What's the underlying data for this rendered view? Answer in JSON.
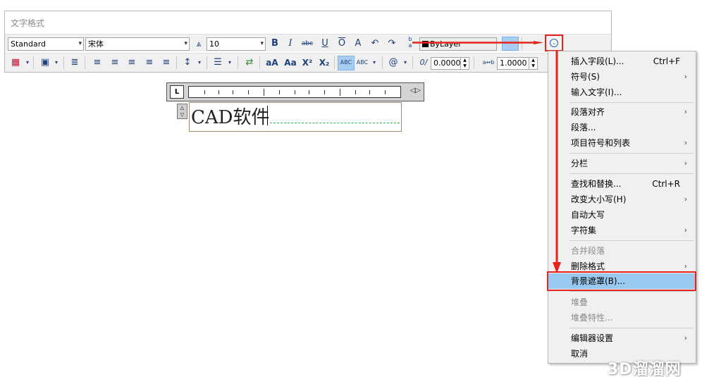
{
  "window": {
    "title": "文字格式"
  },
  "toolbar": {
    "style_value": "Standard",
    "font_value": "宋体",
    "height_value": "10",
    "bold": "B",
    "italic": "I",
    "strike": "abc",
    "underline": "U",
    "overline": "O",
    "stack_top": "b",
    "stack_bottom": "a",
    "color_value": "ByLayer",
    "oblique_value": "0.0000",
    "width_value": "1.0000",
    "uppercase": "aA",
    "lowercase": "Aa",
    "superscript": "X²",
    "subscript": "X₂",
    "symbol": "@",
    "oblique_label": "0/",
    "tracking_label": "a↔b"
  },
  "editor": {
    "text": "CAD软件"
  },
  "menu": {
    "items": [
      {
        "label": "插入字段(L)...",
        "shortcut": "Ctrl+F",
        "submenu": "",
        "disabled": false
      },
      {
        "label": "符号(S)",
        "shortcut": "",
        "submenu": "›",
        "disabled": false
      },
      {
        "label": "输入文字(I)...",
        "shortcut": "",
        "submenu": "",
        "disabled": false
      },
      {
        "label": "段落对齐",
        "shortcut": "",
        "submenu": "›",
        "disabled": false
      },
      {
        "label": "段落...",
        "shortcut": "",
        "submenu": "",
        "disabled": false
      },
      {
        "label": "项目符号和列表",
        "shortcut": "",
        "submenu": "›",
        "disabled": false
      },
      {
        "label": "分栏",
        "shortcut": "",
        "submenu": "›",
        "disabled": false
      },
      {
        "label": "查找和替换...",
        "shortcut": "Ctrl+R",
        "submenu": "",
        "disabled": false
      },
      {
        "label": "改变大小写(H)",
        "shortcut": "",
        "submenu": "›",
        "disabled": false
      },
      {
        "label": "自动大写",
        "shortcut": "",
        "submenu": "",
        "disabled": false
      },
      {
        "label": "字符集",
        "shortcut": "",
        "submenu": "›",
        "disabled": false
      },
      {
        "label": "合并段落",
        "shortcut": "",
        "submenu": "",
        "disabled": true
      },
      {
        "label": "删除格式",
        "shortcut": "",
        "submenu": "›",
        "disabled": false
      },
      {
        "label": "背景遮罩(B)...",
        "shortcut": "",
        "submenu": "",
        "disabled": false,
        "selected": true
      },
      {
        "label": "堆叠",
        "shortcut": "",
        "submenu": "",
        "disabled": true
      },
      {
        "label": "堆叠特性...",
        "shortcut": "",
        "submenu": "",
        "disabled": true
      },
      {
        "label": "编辑器设置",
        "shortcut": "",
        "submenu": "›",
        "disabled": false
      },
      {
        "label": "取消",
        "shortcut": "",
        "submenu": "",
        "disabled": false
      }
    ]
  },
  "colors": {
    "annotation_red": "#e8231b",
    "selection_blue": "#99c9ef"
  },
  "watermark": "3D溜溜网"
}
